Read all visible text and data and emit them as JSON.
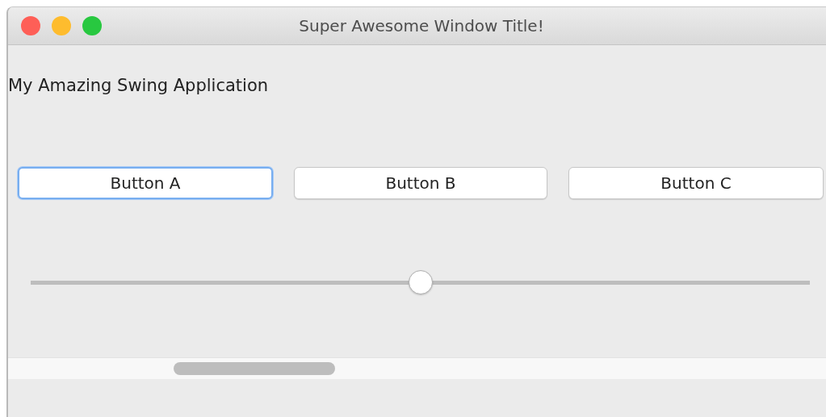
{
  "window": {
    "title": "Super Awesome Window Title!"
  },
  "label": "My Amazing Swing Application",
  "buttons": [
    {
      "label": "Button A",
      "focused": true
    },
    {
      "label": "Button B",
      "focused": false
    },
    {
      "label": "Button C",
      "focused": false
    }
  ],
  "slider": {
    "level": 0.5
  }
}
